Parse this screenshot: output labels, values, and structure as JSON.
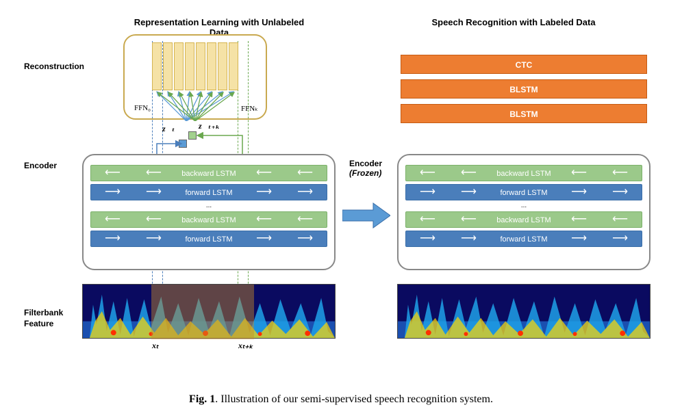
{
  "titles": {
    "left": "Representation Learning with Unlabeled Data",
    "right": "Speech Recognition with Labeled Data"
  },
  "labels": {
    "reconstruction": "Reconstruction",
    "encoder": "Encoder",
    "encoder_frozen_prefix": "Encoder",
    "encoder_frozen_suffix": "(Frozen)",
    "filterbank": "Filterbank\nFeature"
  },
  "ffn": {
    "zero": "FFN₀",
    "k": "FFNₖ"
  },
  "z": {
    "t_arrow": "z⃗ₜ",
    "tk_arrow": "z⃖ₜ₊ₖ"
  },
  "lstm": {
    "bwd": "backward LSTM",
    "fwd": "forward LSTM",
    "dots": "..."
  },
  "orange": {
    "ctc": "CTC",
    "blstm1": "BLSTM",
    "blstm2": "BLSTM"
  },
  "x": {
    "t": "xₜ",
    "tk": "xₜ₊ₖ"
  },
  "caption": {
    "bold": "Fig. 1",
    "text": ". Illustration of our semi-supervised speech recognition system."
  },
  "colors": {
    "orange": "#ed7d31",
    "blue": "#4a7ebb",
    "green": "#9bc98a",
    "yellow": "#f5e2a6"
  }
}
